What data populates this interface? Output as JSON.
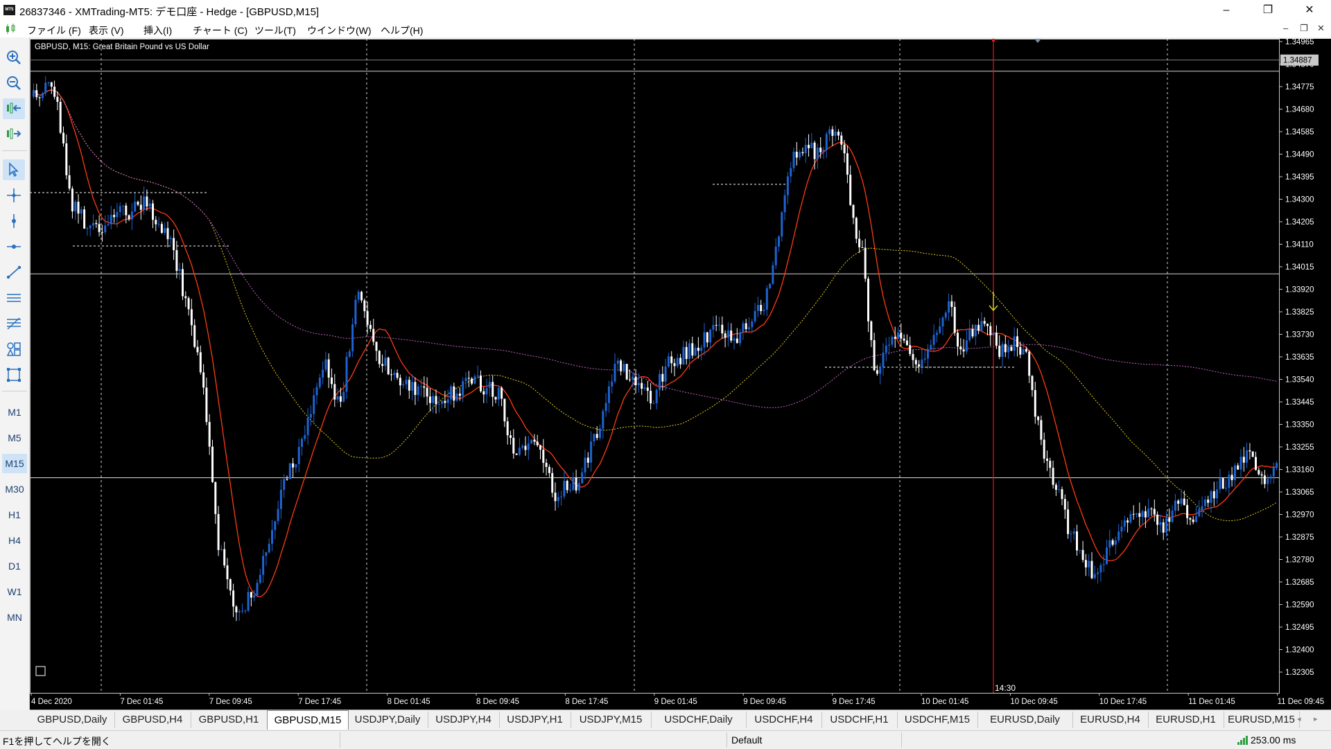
{
  "window": {
    "title": "26837346 - XMTrading-MT5: デモ口座 - Hedge - [GBPUSD,M15]",
    "app_logo_text": "MT5"
  },
  "menu": {
    "items": [
      "ファイル (F)",
      "表示 (V)",
      "挿入(I)",
      "チャート (C)",
      "ツール(T)",
      "ウインドウ(W)",
      "ヘルプ(H)"
    ],
    "mdi_controls": [
      "–",
      "❐",
      "✕"
    ]
  },
  "timeframes": [
    "M1",
    "M5",
    "M15",
    "M30",
    "H1",
    "H4",
    "D1",
    "W1",
    "MN"
  ],
  "active_timeframe": "M15",
  "chart": {
    "info_label": "GBPUSD, M15:  Great Britain Pound vs US Dollar",
    "price_labels": [
      "1.34965",
      "1.34870",
      "1.34775",
      "1.34680",
      "1.34585",
      "1.34490",
      "1.34395",
      "1.34300",
      "1.34205",
      "1.34110",
      "1.34015",
      "1.33920",
      "1.33825",
      "1.33730",
      "1.33635",
      "1.33540",
      "1.33445",
      "1.33350",
      "1.33255",
      "1.33160",
      "1.33065",
      "1.32970",
      "1.32875",
      "1.32780",
      "1.32685",
      "1.32590",
      "1.32495",
      "1.32400",
      "1.32305"
    ],
    "current_price": "1.34887",
    "time_labels": [
      "4 Dec 2020",
      "7 Dec 01:45",
      "7 Dec 09:45",
      "7 Dec 17:45",
      "8 Dec 01:45",
      "8 Dec 09:45",
      "8 Dec 17:45",
      "9 Dec 01:45",
      "9 Dec 09:45",
      "9 Dec 17:45",
      "10 Dec 01:45",
      "10 Dec 09:45",
      "10 Dec 17:45",
      "11 Dec 01:45",
      "11 Dec 09:45"
    ],
    "crosshair_time": "14:30",
    "colors": {
      "background": "#000000",
      "bull_candle": "#1e64d2",
      "bear_candle": "#ffffff",
      "ma_fast": "#ff3c14",
      "ma_slow": "#e6d21e",
      "ma_long": "#c864c8",
      "vertical_marker": "#e01e1e"
    }
  },
  "tabs": [
    "GBPUSD,Daily",
    "GBPUSD,H4",
    "GBPUSD,H1",
    "GBPUSD,M15",
    "USDJPY,Daily",
    "USDJPY,H4",
    "USDJPY,H1",
    "USDJPY,M15",
    "USDCHF,Daily",
    "USDCHF,H4",
    "USDCHF,H1",
    "USDCHF,M15",
    "EURUSD,Daily",
    "EURUSD,H4",
    "EURUSD,H1",
    "EURUSD,M15"
  ],
  "active_tab": "GBPUSD,M15",
  "tab_nav": [
    "◂",
    "▸"
  ],
  "status": {
    "help": "F1を押してヘルプを開く",
    "profile": "Default",
    "ping": "253.00 ms"
  }
}
